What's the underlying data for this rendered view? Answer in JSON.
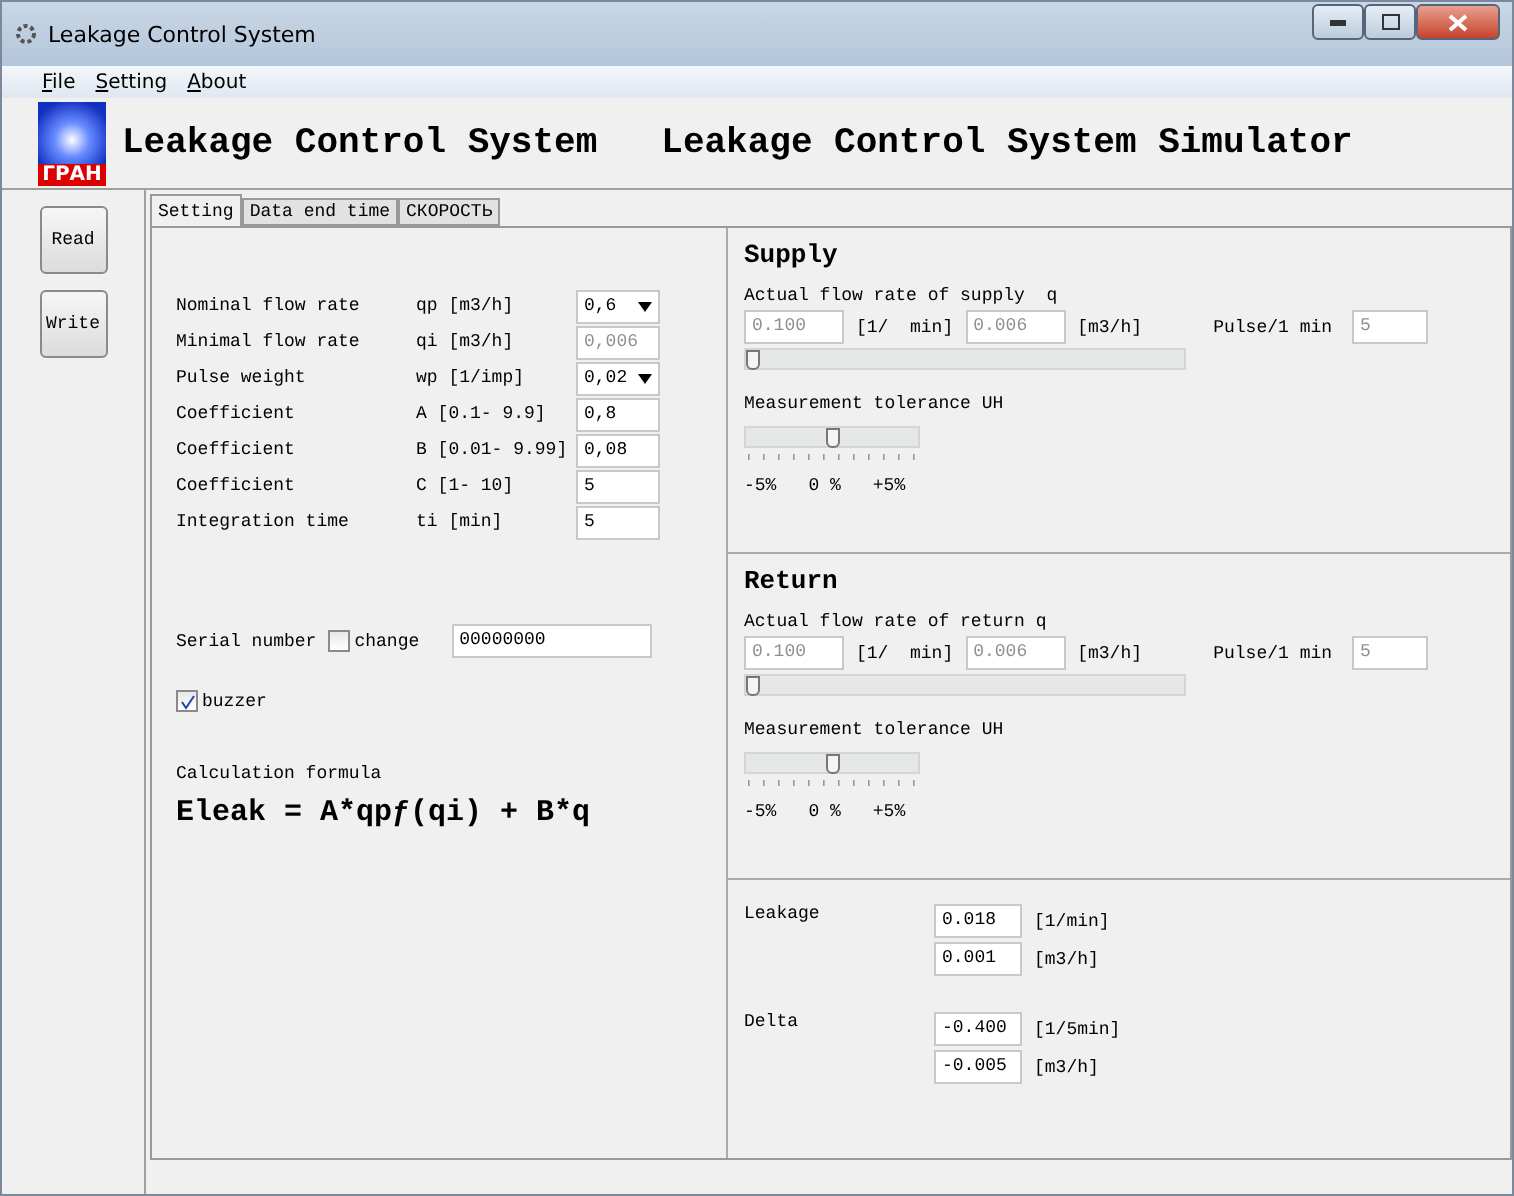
{
  "window": {
    "title": "Leakage Control System"
  },
  "menu": [
    {
      "label": "File"
    },
    {
      "label": "Setting"
    },
    {
      "label": "About"
    }
  ],
  "header": {
    "logo_text": "ГРАН",
    "title": "Leakage Control System",
    "subtitle": "Leakage Control System Simulator"
  },
  "side_buttons": [
    "Read",
    "Write"
  ],
  "tabs": [
    {
      "label": "Setting",
      "selected": true
    },
    {
      "label": "Data end time",
      "selected": false
    },
    {
      "label": "СКОРОСТЬ",
      "selected": false
    }
  ],
  "parameters": [
    {
      "label": "Nominal flow rate",
      "symbol": "qp [m3/h]",
      "value": "0,6",
      "kind": "dropdown",
      "disabled": false
    },
    {
      "label": "Minimal flow rate",
      "symbol": "qi [m3/h]",
      "value": "0,006",
      "kind": "input",
      "disabled": true
    },
    {
      "label": "Pulse weight",
      "symbol": "wp [1/imp]",
      "value": "0,02",
      "kind": "dropdown",
      "disabled": false
    },
    {
      "label": "Coefficient",
      "symbol": "A [0.1- 9.9]",
      "value": "0,8",
      "kind": "input",
      "disabled": false
    },
    {
      "label": "Coefficient",
      "symbol": "B [0.01- 9.99]",
      "value": "0,08",
      "kind": "input",
      "disabled": false
    },
    {
      "label": "Coefficient",
      "symbol": "C [1- 10]",
      "value": "5",
      "kind": "input",
      "disabled": false
    },
    {
      "label": "Integration time",
      "symbol": "ti [min]",
      "value": "5",
      "kind": "input",
      "disabled": false
    }
  ],
  "serial": {
    "label": "Serial number",
    "change_label": "change",
    "change_checked": false,
    "value": "00000000"
  },
  "buzzer": {
    "label": "buzzer",
    "checked": true
  },
  "formula": {
    "caption": "Calculation formula",
    "text": "Eleak = A*qpƒ(qi) + B*q"
  },
  "sections": [
    {
      "title": "Supply",
      "flow_label": "Actual flow rate of supply  q",
      "flow_lmin": "0.100",
      "unit_lmin": "[1/  min]",
      "flow_m3h": "0.006",
      "unit_m3h": "[m3/h]",
      "pulse_label": "Pulse/1 min",
      "pulse": "5",
      "flow_slider": {
        "level": 0.0
      },
      "tolerance_label": "Measurement tolerance UH",
      "tolerance_slider": {
        "level": 0.5
      },
      "scale": [
        "-5%",
        "0 %",
        "+5%"
      ]
    },
    {
      "title": "Return",
      "flow_label": "Actual flow rate of return q",
      "flow_lmin": "0.100",
      "unit_lmin": "[1/  min]",
      "flow_m3h": "0.006",
      "unit_m3h": "[m3/h]",
      "pulse_label": "Pulse/1 min",
      "pulse": "5",
      "flow_slider": {
        "level": 0.0
      },
      "tolerance_label": "Measurement tolerance UH",
      "tolerance_slider": {
        "level": 0.5
      },
      "scale": [
        "-5%",
        "0 %",
        "+5%"
      ]
    }
  ],
  "results": [
    {
      "label": "Leakage",
      "rows": [
        {
          "value": "0.018",
          "unit": "[1/min]"
        },
        {
          "value": "0.001",
          "unit": "[m3/h]"
        }
      ]
    },
    {
      "label": "Delta",
      "rows": [
        {
          "value": "-0.400",
          "unit": "[1/5min]"
        },
        {
          "value": "-0.005",
          "unit": "[m3/h]"
        }
      ]
    }
  ]
}
